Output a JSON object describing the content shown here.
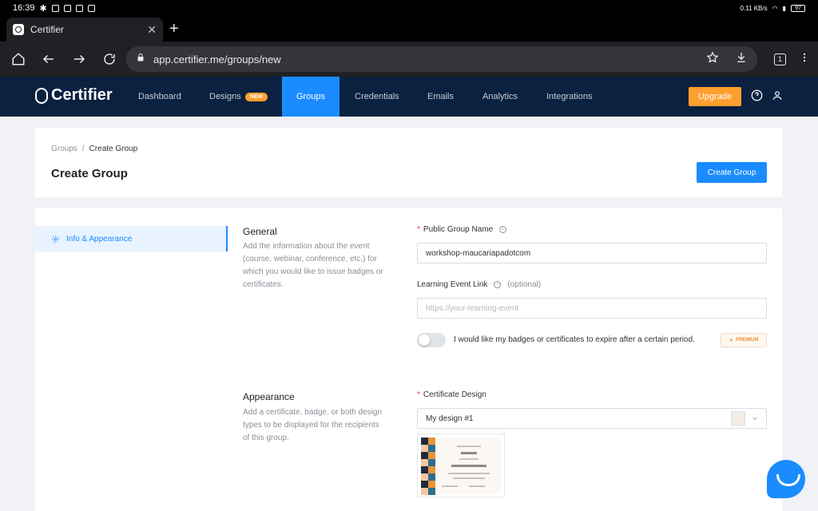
{
  "status_bar": {
    "time": "16:39",
    "net_speed": "0.11 KB/s",
    "battery": "97"
  },
  "tab": {
    "title": "Certifier"
  },
  "address": {
    "url": "app.certifier.me/groups/new"
  },
  "browser": {
    "tab_count": "1"
  },
  "nav": {
    "logo": "Certifier",
    "items": [
      {
        "label": "Dashboard"
      },
      {
        "label": "Designs",
        "badge": "NEW"
      },
      {
        "label": "Groups"
      },
      {
        "label": "Credentials"
      },
      {
        "label": "Emails"
      },
      {
        "label": "Analytics"
      },
      {
        "label": "Integrations"
      }
    ],
    "upgrade": "Upgrade",
    "active_color": "#1a8cff",
    "brand_color": "#0b2140"
  },
  "header": {
    "breadcrumb_parent": "Groups",
    "breadcrumb_sep": "/",
    "breadcrumb_current": "Create Group",
    "title": "Create Group",
    "create_button": "Create Group"
  },
  "sidebar": {
    "item": "Info & Appearance"
  },
  "general": {
    "title": "General",
    "description": "Add the information about the event (course, webinar, conference, etc.) for which you would like to issue badges or certificates.",
    "group_name_label": "Public Group Name",
    "group_name_value": "workshop-maucariapadotcom",
    "event_link_label": "Learning Event Link",
    "event_link_optional": "(optional)",
    "event_link_placeholder": "https://your-learning-event",
    "expire_toggle_label": "I would like my badges or certificates to expire after a certain period.",
    "premium_badge": "PREMIUM"
  },
  "appearance": {
    "title": "Appearance",
    "description": "Add a certificate, badge, or both design types to be displayed for the recipients of this group.",
    "design_label": "Certificate Design",
    "design_value": "My design #1"
  }
}
